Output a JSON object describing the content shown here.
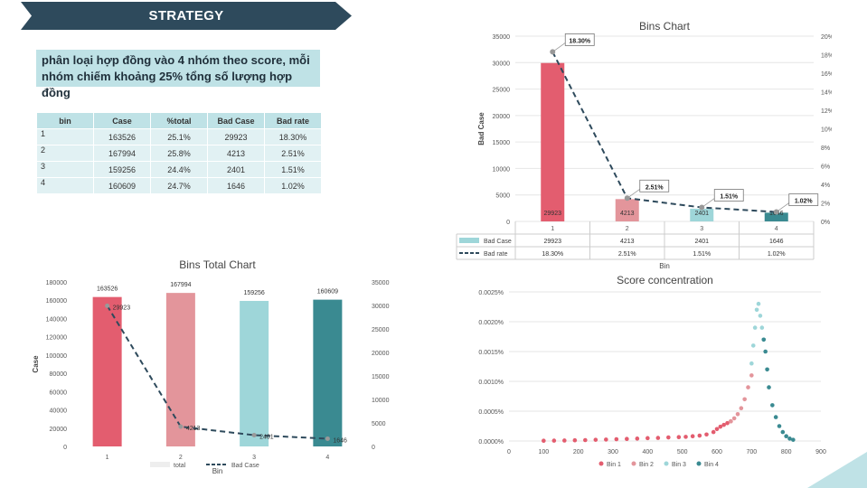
{
  "header": {
    "title": "STRATEGY"
  },
  "description": "phân loại hợp đồng vào 4 nhóm  theo score, mỗi nhóm chiếm khoảng 25% tổng số lượng hợp đồng",
  "summary_table": {
    "headers": [
      "bin",
      "Case",
      "%total",
      "Bad Case",
      "Bad rate"
    ],
    "rows": [
      [
        "1",
        "163526",
        "25.1%",
        "29923",
        "18.30%"
      ],
      [
        "2",
        "167994",
        "25.8%",
        "4213",
        "2.51%"
      ],
      [
        "3",
        "159256",
        "24.4%",
        "2401",
        "1.51%"
      ],
      [
        "4",
        "160609",
        "24.7%",
        "1646",
        "1.02%"
      ]
    ]
  },
  "colors": {
    "banner": "#2e4a5c",
    "bin1": "#e35d6f",
    "bin2": "#e3959b",
    "bin3": "#9ed6d9",
    "bin4": "#3a8a91",
    "line": "#2e4a5c",
    "teal_light": "#bfe2e6"
  },
  "chart_data": [
    {
      "id": "bins_chart",
      "type": "bar",
      "title": "Bins Chart",
      "xlabel": "Bin",
      "ylabel": "Bad Case",
      "categories": [
        "1",
        "2",
        "3",
        "4"
      ],
      "ylim": [
        0,
        35000
      ],
      "yticks": [
        "0",
        "5000",
        "10000",
        "15000",
        "20000",
        "25000",
        "30000",
        "35000"
      ],
      "y2lim": [
        0,
        20
      ],
      "y2ticks": [
        "0%",
        "2%",
        "4%",
        "6%",
        "8%",
        "10%",
        "12%",
        "14%",
        "16%",
        "18%",
        "20%"
      ],
      "series": [
        {
          "name": "Bad Case",
          "type": "bar",
          "values": [
            29923,
            4213,
            2401,
            1646
          ],
          "labels": [
            "29923",
            "4213",
            "2401",
            "1646"
          ]
        },
        {
          "name": "Bad rate",
          "type": "line",
          "axis": "secondary",
          "values": [
            18.3,
            2.51,
            1.51,
            1.02
          ],
          "labels": [
            "18.30%",
            "2.51%",
            "1.51%",
            "1.02%"
          ]
        }
      ],
      "data_table": true
    },
    {
      "id": "bins_total_chart",
      "type": "bar",
      "title": "Bins Total Chart",
      "xlabel": "Bin",
      "ylabel": "Case",
      "categories": [
        "1",
        "2",
        "3",
        "4"
      ],
      "ylim": [
        0,
        180000
      ],
      "yticks": [
        "0",
        "20000",
        "40000",
        "60000",
        "80000",
        "100000",
        "120000",
        "140000",
        "160000",
        "180000"
      ],
      "y2lim": [
        0,
        35000
      ],
      "y2ticks": [
        "0",
        "5000",
        "10000",
        "15000",
        "20000",
        "25000",
        "30000",
        "35000"
      ],
      "series": [
        {
          "name": "total",
          "type": "bar",
          "values": [
            163526,
            167994,
            159256,
            160609
          ],
          "labels": [
            "163526",
            "167994",
            "159256",
            "160609"
          ]
        },
        {
          "name": "Bad Case",
          "type": "line",
          "axis": "secondary",
          "values": [
            29923,
            4213,
            2401,
            1646
          ],
          "labels": [
            "29923",
            "4213",
            "2401",
            "1646"
          ]
        }
      ],
      "legend": "bottom"
    },
    {
      "id": "score_concentration",
      "type": "scatter",
      "title": "Score concentration",
      "xlim": [
        0,
        900
      ],
      "xticks": [
        "0",
        "100",
        "200",
        "300",
        "400",
        "500",
        "600",
        "700",
        "800",
        "900"
      ],
      "ylim": [
        0,
        0.0025
      ],
      "yticks": [
        "0.0000%",
        "0.0005%",
        "0.0010%",
        "0.0015%",
        "0.0020%",
        "0.0025%"
      ],
      "legend": "bottom",
      "series": [
        {
          "name": "Bin 1",
          "points": [
            [
              100,
              4e-06
            ],
            [
              130,
              6e-06
            ],
            [
              160,
              8e-06
            ],
            [
              190,
              1.2e-05
            ],
            [
              220,
              1.5e-05
            ],
            [
              250,
              2e-05
            ],
            [
              280,
              2.4e-05
            ],
            [
              310,
              3e-05
            ],
            [
              340,
              3.5e-05
            ],
            [
              370,
              4e-05
            ],
            [
              400,
              4.8e-05
            ],
            [
              430,
              5.2e-05
            ],
            [
              460,
              6e-05
            ],
            [
              490,
              6.5e-05
            ],
            [
              510,
              7e-05
            ],
            [
              530,
              8e-05
            ],
            [
              550,
              9e-05
            ],
            [
              570,
              0.00011
            ],
            [
              590,
              0.00015
            ],
            [
              600,
              0.0002
            ],
            [
              610,
              0.00024
            ],
            [
              620,
              0.00027
            ],
            [
              630,
              0.0003
            ],
            [
              640,
              0.00033
            ]
          ]
        },
        {
          "name": "Bin 2",
          "points": [
            [
              640,
              0.00033
            ],
            [
              650,
              0.00038
            ],
            [
              660,
              0.00045
            ],
            [
              670,
              0.00055
            ],
            [
              680,
              0.0007
            ],
            [
              690,
              0.0009
            ],
            [
              700,
              0.0011
            ]
          ]
        },
        {
          "name": "Bin 3",
          "points": [
            [
              700,
              0.0013
            ],
            [
              705,
              0.0016
            ],
            [
              710,
              0.0019
            ],
            [
              715,
              0.0022
            ],
            [
              720,
              0.0023
            ],
            [
              725,
              0.0021
            ],
            [
              730,
              0.0019
            ],
            [
              735,
              0.0017
            ]
          ]
        },
        {
          "name": "Bin 4",
          "points": [
            [
              735,
              0.0017
            ],
            [
              740,
              0.0015
            ],
            [
              745,
              0.0012
            ],
            [
              750,
              0.0009
            ],
            [
              760,
              0.0006
            ],
            [
              770,
              0.0004
            ],
            [
              780,
              0.00025
            ],
            [
              790,
              0.00015
            ],
            [
              800,
              8e-05
            ],
            [
              810,
              4e-05
            ],
            [
              820,
              2e-05
            ]
          ]
        }
      ]
    }
  ]
}
